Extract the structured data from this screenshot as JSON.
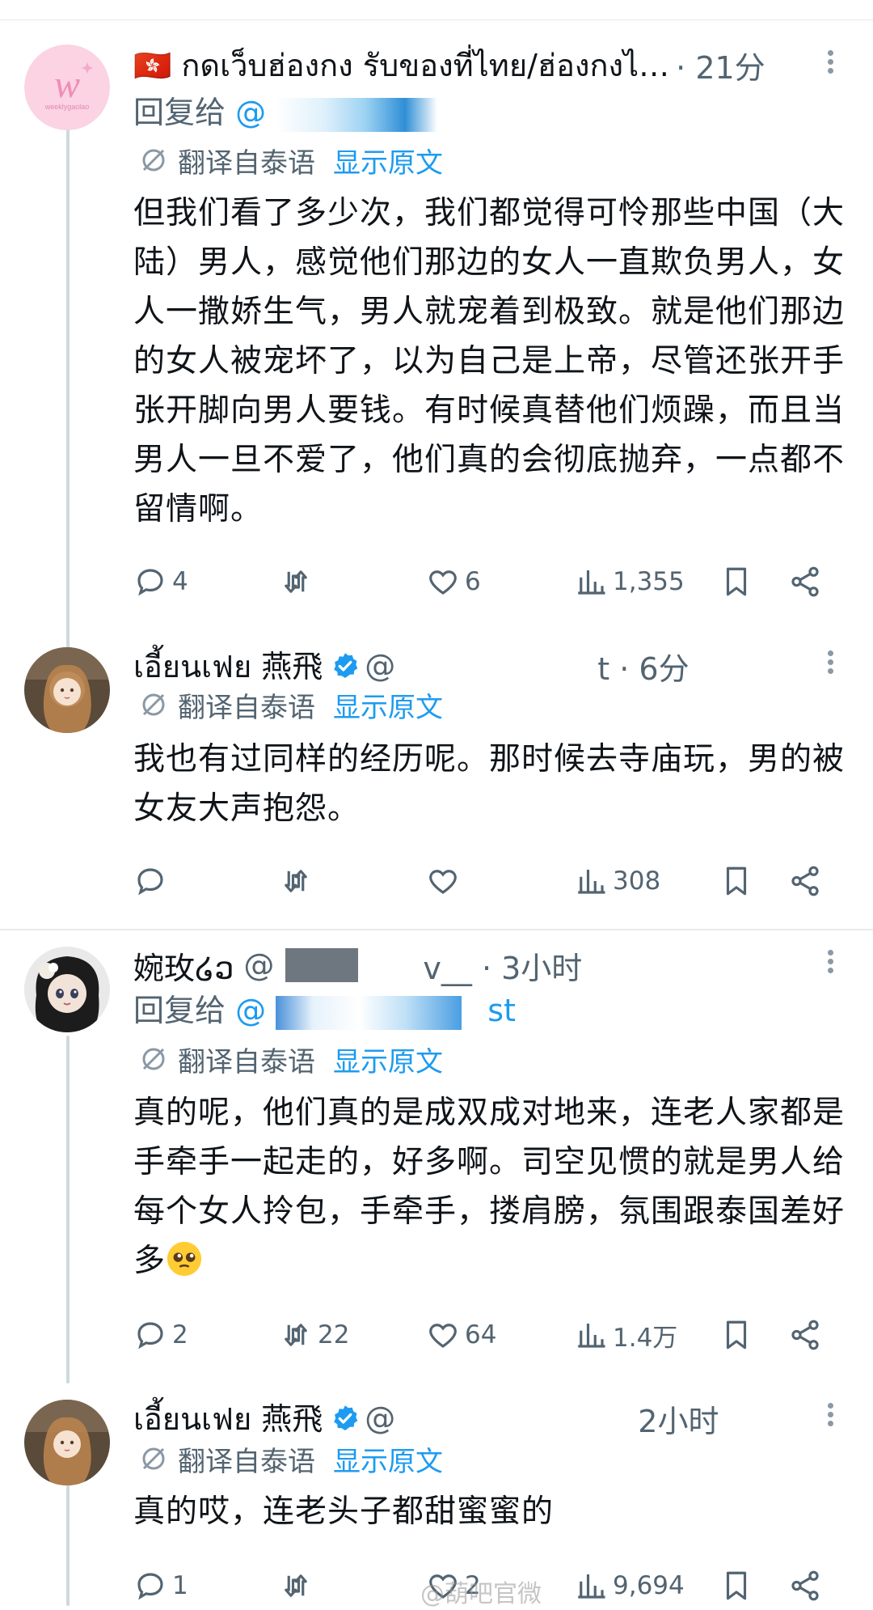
{
  "translate": {
    "label": "翻译自泰语",
    "link": "显示原文"
  },
  "posts": [
    {
      "name": "🇭🇰 กดเว็บฮ่องกง รับของที่ไทย/ฮ่องกงไ…",
      "handle": "",
      "time": "· 21分",
      "reply_prefix": "回复给",
      "reply_handle": "@",
      "body": "但我们看了多少次，我们都觉得可怜那些中国（大陆）男人，感觉他们那边的女人一直欺负男人，女人一撒娇生气，男人就宠着到极致。就是他们那边的女人被宠坏了，以为自己是上帝，尽管还张开手张开脚向男人要钱。有时候真替他们烦躁，而且当男人一旦不爱了，他们真的会彻底抛弃，一点都不留情啊。",
      "avatar_text": "weeklygaolao",
      "avatar_letter": "w",
      "replies": "4",
      "retweets": "",
      "likes": "6",
      "views": "1,355"
    },
    {
      "name": "เอี้ยนเฟย 燕飛",
      "handle": "@",
      "time": "t · 6分",
      "body": "我也有过同样的经历呢。那时候去寺庙玩，男的被女友大声抱怨。",
      "replies": "",
      "retweets": "",
      "likes": "",
      "views": "308"
    },
    {
      "name": "婉玫໒ວ",
      "handle": "@",
      "time": "v__ · 3小时",
      "reply_prefix": "回复给",
      "reply_handle": "@",
      "reply_suffix": "st",
      "body": "真的呢，他们真的是成双成对地来，连老人家都是手牵手一起走的，好多啊。司空见惯的就是男人给每个女人拎包，手牵手，搂肩膀，氛围跟泰国差好多",
      "replies": "2",
      "retweets": "22",
      "likes": "64",
      "views": "1.4万"
    },
    {
      "name": "เอี้ยนเฟย 燕飛",
      "handle": "@",
      "time": "2小时",
      "body": "真的哎，连老头子都甜蜜蜜的",
      "replies": "1",
      "retweets": "",
      "likes": "2",
      "views": "9,694"
    }
  ],
  "watermark": "@葫吧官微",
  "colors": {
    "accent": "#1d9bf0",
    "muted": "#536471",
    "verified": "#1d9bf0"
  }
}
